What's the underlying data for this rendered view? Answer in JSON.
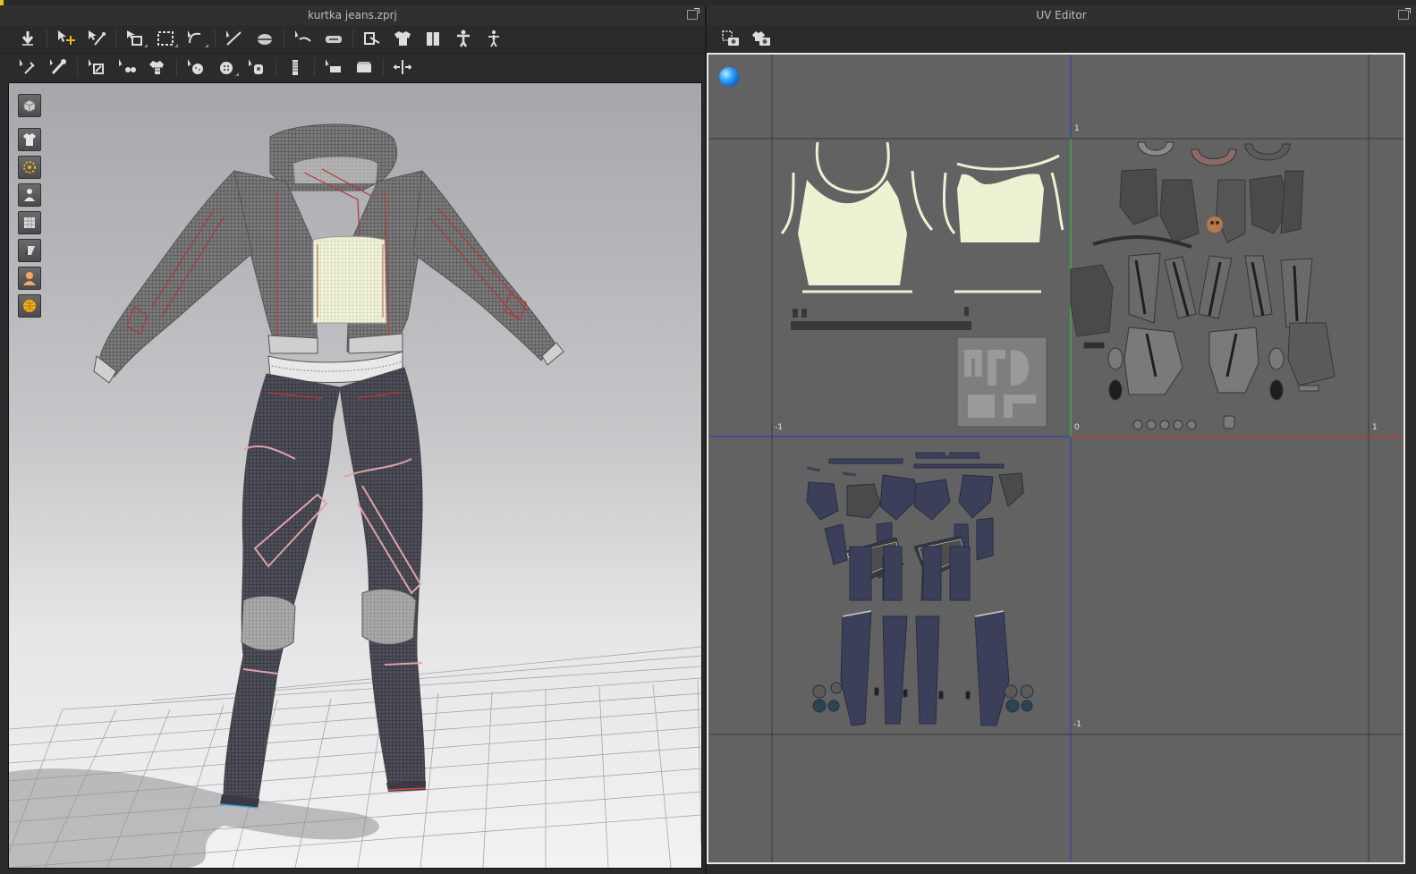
{
  "left_panel": {
    "title": "kurtka jeans.zprj",
    "toolbar_row1": [
      "move-down-tool",
      "select-move-tool",
      "edit-pattern-tool",
      "segment-tool",
      "rectangle-tool",
      "circle-tool",
      "line-tool",
      "sewing-tool",
      "free-sewing-tool",
      "fold-tool",
      "garment-front-tool",
      "garment-side-tool",
      "avatar-tool",
      "pose-tool"
    ],
    "toolbar_row2": [
      "pin-tool",
      "tack-tool",
      "fold-arrange-tool",
      "arrangement-tool",
      "fitting-tool",
      "button-tool",
      "buttonhole-tool",
      "snap-tool",
      "zipper-tool",
      "puckering-tool",
      "elastic-tool",
      "measure-tool"
    ],
    "viewport_icons": [
      "view-cube-icon",
      "garment-icon",
      "arrangement-points-icon",
      "avatar-display-icon",
      "texture-icon",
      "normal-map-icon",
      "skin-icon",
      "environment-icon"
    ]
  },
  "right_panel": {
    "title": "UV Editor",
    "toolbar": [
      "snapshot-icon",
      "snapshot-all-icon"
    ],
    "axis_labels": {
      "top_one": "1",
      "left_minus_one": "-1",
      "origin_zero": "0",
      "right_one": "1",
      "bottom_minus_one": "-1"
    }
  },
  "colors": {
    "axis_x": "#c3323a",
    "axis_y": "#2fbf3a",
    "axis_blue": "#2b2bd6",
    "accent": "#f2b21b"
  }
}
